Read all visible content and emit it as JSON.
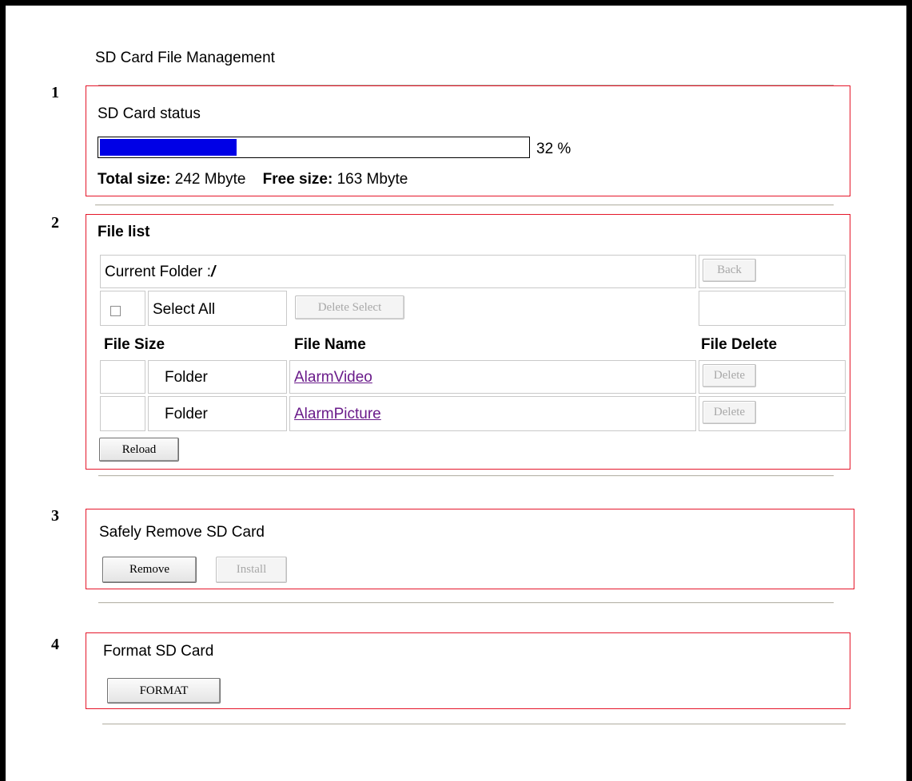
{
  "page": {
    "title": "SD Card File Management"
  },
  "markers": [
    "1",
    "2",
    "3",
    "4"
  ],
  "status": {
    "title": "SD Card status",
    "usage_percent": 32,
    "usage_label": "32 %",
    "total_label": "Total size:",
    "total_value": "242 Mbyte",
    "free_label": "Free size:",
    "free_value": "163 Mbyte",
    "bar_color": "#0000e6"
  },
  "file_list": {
    "title": "File list",
    "current_folder_label": "Current Folder :",
    "current_folder_value": "/",
    "back_button": "Back",
    "select_all_label": "Select All",
    "delete_select_button": "Delete Select",
    "headers": {
      "size": "File Size",
      "name": "File Name",
      "delete": "File Delete"
    },
    "rows": [
      {
        "size": "Folder",
        "name": "AlarmVideo",
        "delete": "Delete"
      },
      {
        "size": "Folder",
        "name": "AlarmPicture",
        "delete": "Delete"
      }
    ],
    "reload_button": "Reload"
  },
  "remove": {
    "title": "Safely Remove SD Card",
    "remove_button": "Remove",
    "install_button": "Install"
  },
  "format": {
    "title": "Format SD Card",
    "format_button": "FORMAT"
  },
  "colors": {
    "highlight_box": "#e5162a",
    "link": "#6a1b8a"
  }
}
